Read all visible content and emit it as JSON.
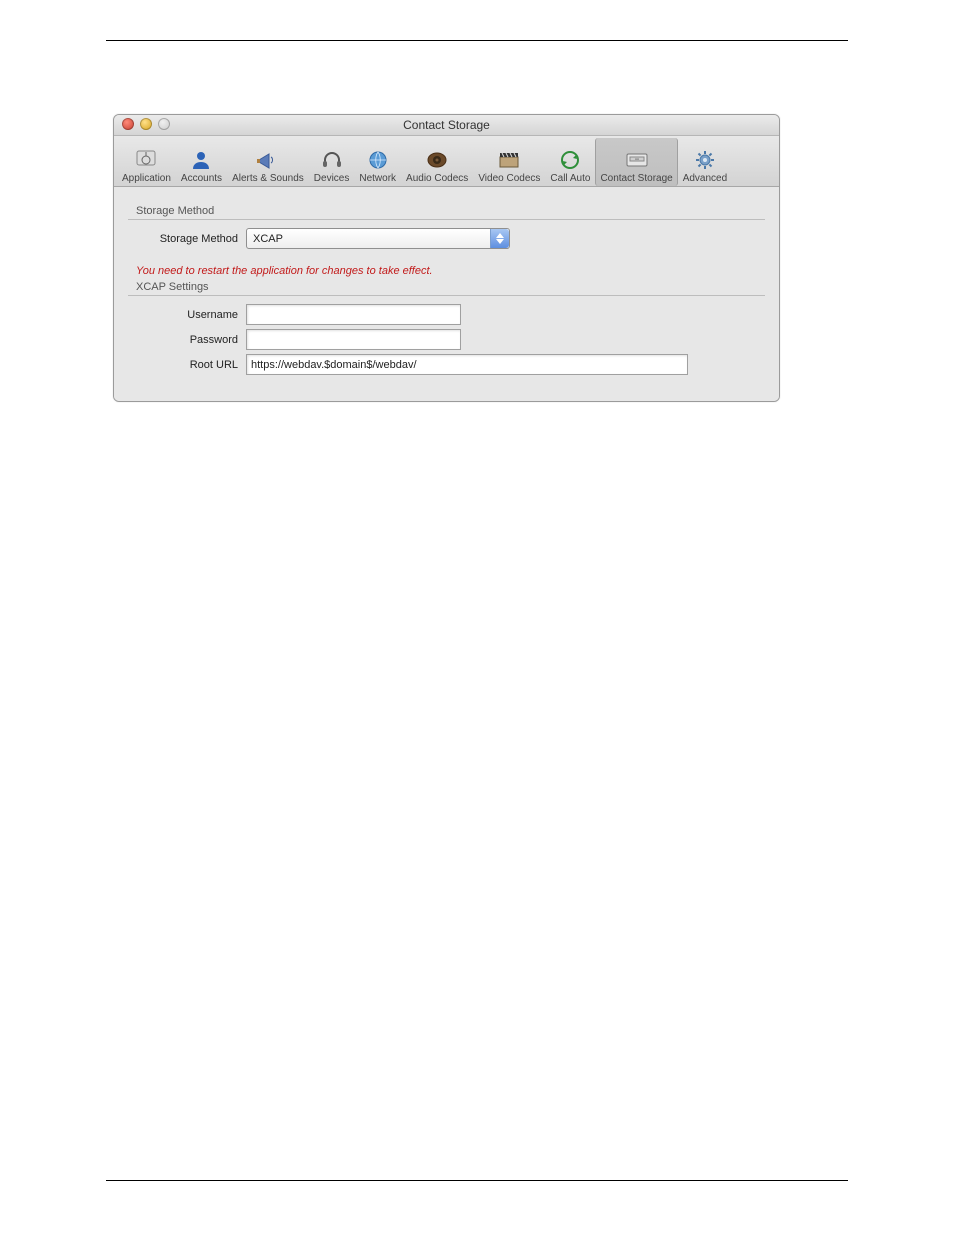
{
  "window": {
    "title": "Contact Storage"
  },
  "toolbar": {
    "items": [
      {
        "label": "Application"
      },
      {
        "label": "Accounts"
      },
      {
        "label": "Alerts & Sounds"
      },
      {
        "label": "Devices"
      },
      {
        "label": "Network"
      },
      {
        "label": "Audio Codecs"
      },
      {
        "label": "Video Codecs"
      },
      {
        "label": "Call Auto"
      },
      {
        "label": "Contact Storage"
      },
      {
        "label": "Advanced"
      }
    ]
  },
  "storage_method": {
    "group_title": "Storage Method",
    "label": "Storage Method",
    "value": "XCAP"
  },
  "restart_warning": "You need to restart the application for changes to take effect.",
  "xcap": {
    "group_title": "XCAP Settings",
    "username_label": "Username",
    "username_value": "",
    "password_label": "Password",
    "password_value": "",
    "rooturl_label": "Root URL",
    "rooturl_value": "https://webdav.$domain$/webdav/"
  }
}
